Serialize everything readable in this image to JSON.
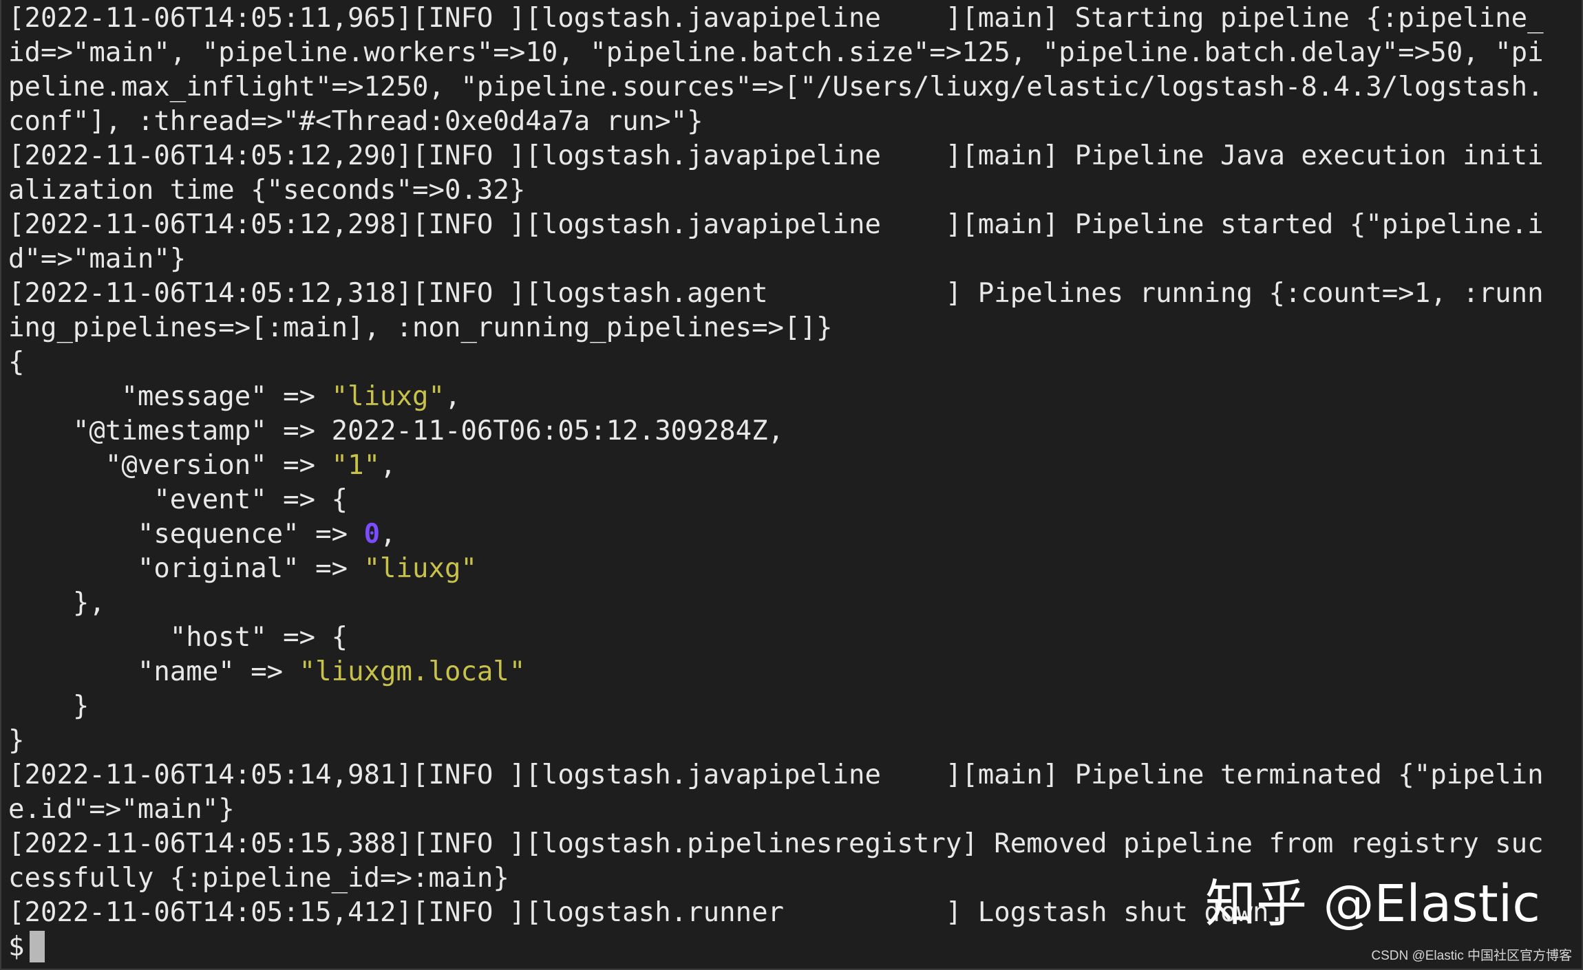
{
  "terminal": {
    "lines": [
      "[2022-11-06T14:05:11,965][INFO ][logstash.javapipeline    ][main] Starting pipeline {:pipeline_",
      "id=>\"main\", \"pipeline.workers\"=>10, \"pipeline.batch.size\"=>125, \"pipeline.batch.delay\"=>50, \"pi",
      "peline.max_inflight\"=>1250, \"pipeline.sources\"=>[\"/Users/liuxg/elastic/logstash-8.4.3/logstash.",
      "conf\"], :thread=>\"#<Thread:0xe0d4a7a run>\"}",
      "[2022-11-06T14:05:12,290][INFO ][logstash.javapipeline    ][main] Pipeline Java execution initi",
      "alization time {\"seconds\"=>0.32}",
      "[2022-11-06T14:05:12,298][INFO ][logstash.javapipeline    ][main] Pipeline started {\"pipeline.i",
      "d\"=>\"main\"}",
      "[2022-11-06T14:05:12,318][INFO ][logstash.agent           ] Pipelines running {:count=>1, :runn",
      "ing_pipelines=>[:main], :non_running_pipelines=>[]}"
    ],
    "event": {
      "open_brace": "{",
      "message_key": "       \"message\" => ",
      "message_value": "\"liuxg\"",
      "message_tail": ",",
      "timestamp_line": "    \"@timestamp\" => 2022-11-06T06:05:12.309284Z,",
      "version_key": "      \"@version\" => ",
      "version_value": "\"1\"",
      "version_tail": ",",
      "event_open": "         \"event\" => {",
      "sequence_key": "        \"sequence\" => ",
      "sequence_value": "0",
      "sequence_tail": ",",
      "original_key": "        \"original\" => ",
      "original_value": "\"liuxg\"",
      "event_close": "    },",
      "host_open": "          \"host\" => {",
      "name_key": "        \"name\" => ",
      "name_value": "\"liuxgm.local\"",
      "host_close": "    }",
      "close_brace": "}"
    },
    "tail_lines": [
      "[2022-11-06T14:05:14,981][INFO ][logstash.javapipeline    ][main] Pipeline terminated {\"pipelin",
      "e.id\"=>\"main\"}",
      "[2022-11-06T14:05:15,388][INFO ][logstash.pipelinesregistry] Removed pipeline from registry suc",
      "cessfully {:pipeline_id=>:main}",
      "[2022-11-06T14:05:15,412][INFO ][logstash.runner          ] Logstash shut down."
    ],
    "prompt": "$"
  },
  "watermark": "知乎 @Elastic",
  "credit": "CSDN @Elastic 中国社区官方博客",
  "colors": {
    "background": "#1e1e1e",
    "text": "#e8e8e8",
    "string": "#c9c24a",
    "number": "#7b4dff"
  }
}
